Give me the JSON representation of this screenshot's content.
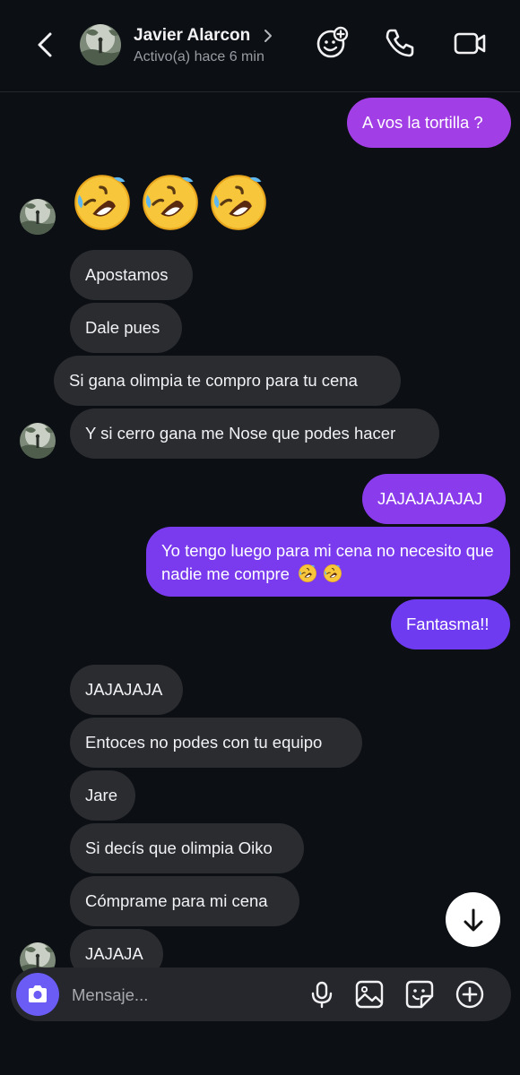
{
  "header": {
    "contact_name": "Javier Alarcon",
    "status": "Activo(a) hace 6 min"
  },
  "colors": {
    "background": "#0c0f14",
    "incoming_bubble": "#2a2c30",
    "outgoing_gradient_top": "#a43ee6",
    "outgoing_gradient_bottom": "#6f3bf0",
    "camera_button": "#6b5cf6"
  },
  "messages": {
    "m1": "A vos la tortilla ?",
    "m2": "Apostamos",
    "m3": "Dale pues",
    "m4": "Si gana olimpia te compro para tu cena",
    "m5": "Y si cerro gana me Nose que podes hacer",
    "m6": "JAJAJAJAJAJ",
    "m7": "Yo tengo luego para mi cena no necesito que nadie me compre",
    "m8": "Fantasma!!",
    "m9": "JAJAJAJA",
    "m10": "Entoces no podes con tu equipo",
    "m11": "Jare",
    "m12": "Si decís que olimpia Oiko",
    "m13": "Cómprame para mi cena",
    "m14": "JAJAJA"
  },
  "emoji_reaction": [
    "rolling-on-floor-laughing",
    "rolling-on-floor-laughing",
    "rolling-on-floor-laughing"
  ],
  "composer": {
    "placeholder": "Mensaje..."
  },
  "icons": [
    "back-icon",
    "chevron-right-icon",
    "effects-icon",
    "phone-icon",
    "video-icon",
    "camera-icon",
    "microphone-icon",
    "gallery-icon",
    "sticker-icon",
    "plus-icon",
    "arrow-down-icon"
  ]
}
